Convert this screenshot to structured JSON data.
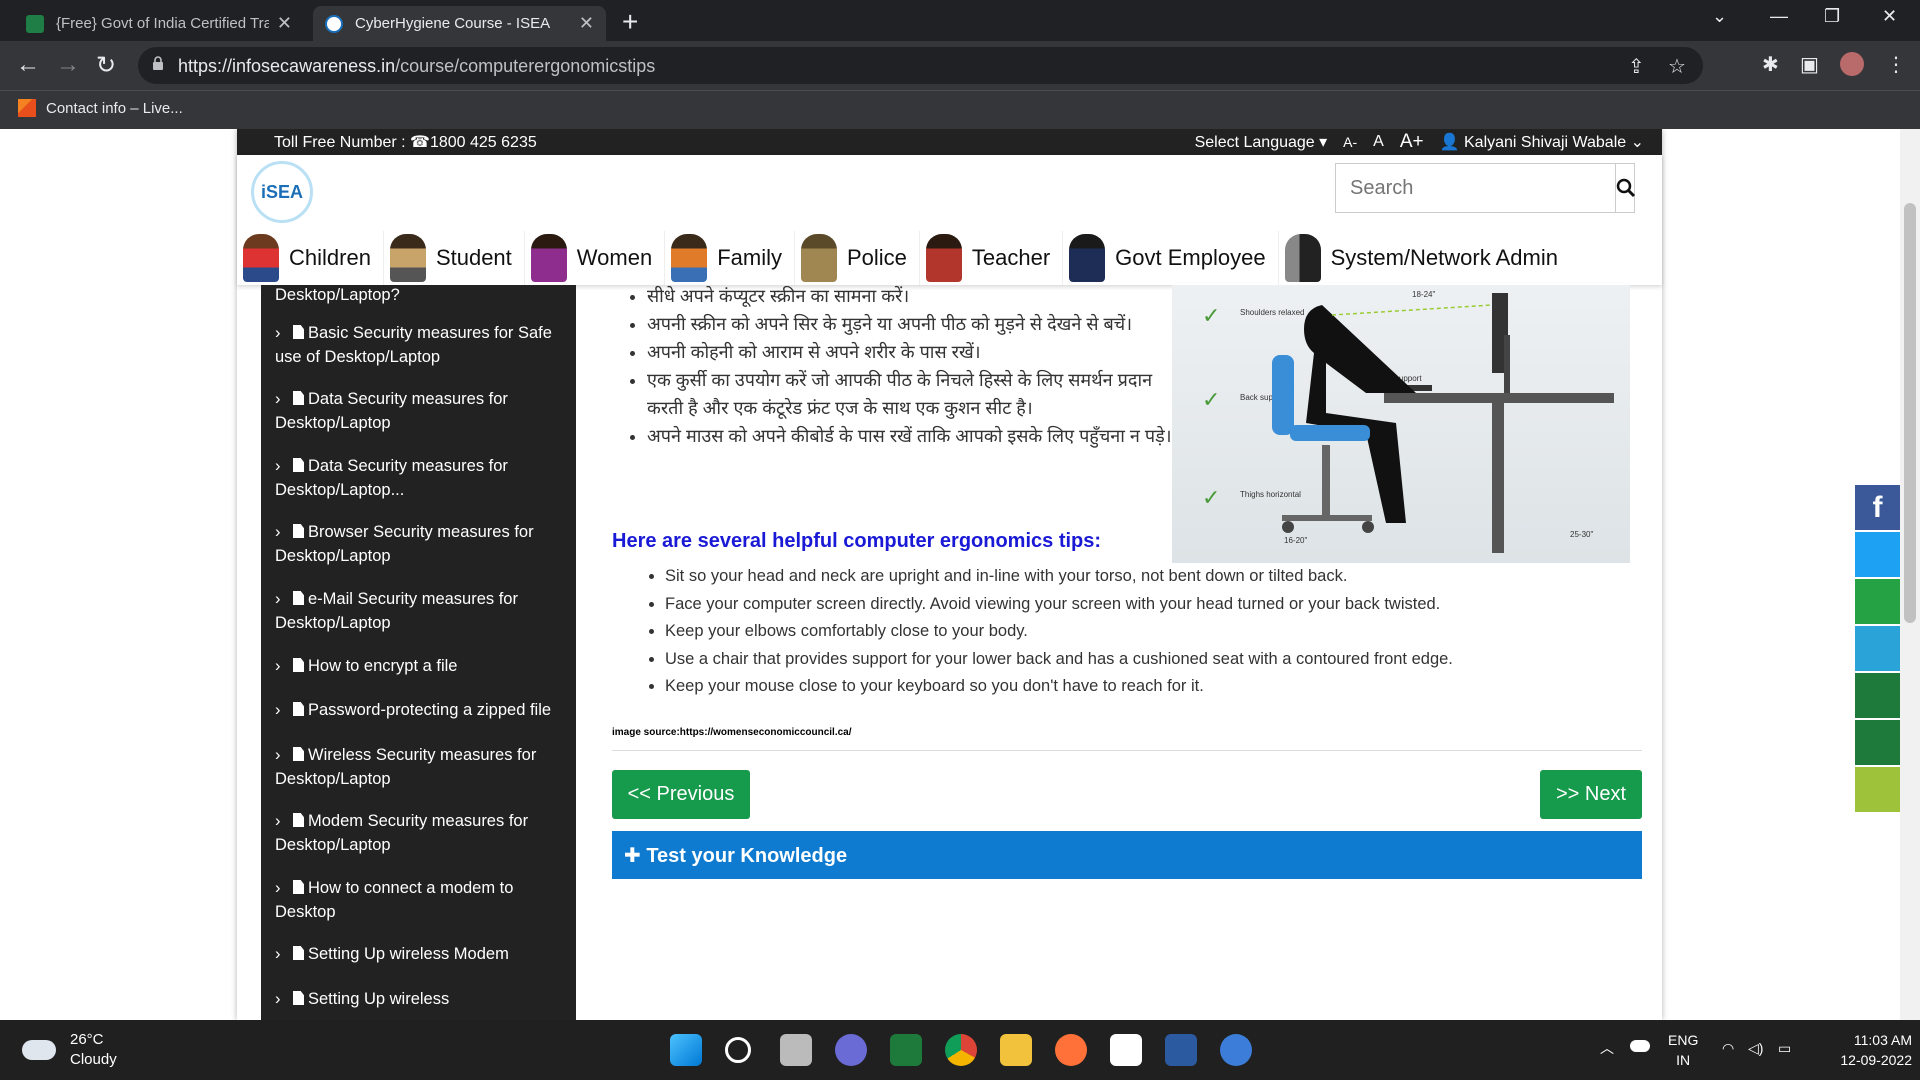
{
  "browser": {
    "tabs": [
      {
        "title": "{Free} Govt of India Certified Trai",
        "active": false
      },
      {
        "title": "CyberHygiene Course - ISEA",
        "active": true
      }
    ],
    "url_host": "https://infosecawareness.in",
    "url_path": "/course/computerergonomicstips",
    "bookmark": "Contact info – Live..."
  },
  "site": {
    "toll_free": "Toll Free Number : ☎1800 425 6235",
    "select_language": "Select Language ▾",
    "font_small": "A-",
    "font_normal": "A",
    "font_large": "A+",
    "user": "👤 Kalyani Shivaji Wabale ⌄",
    "logo_text": "iSEA",
    "search_placeholder": "Search",
    "menu": [
      "Children",
      "Student",
      "Women",
      "Family",
      "Police",
      "Teacher",
      "Govt Employee",
      "System/Network Admin"
    ]
  },
  "sidebar": {
    "items": [
      "Desktop/Laptop?",
      "Basic Security measures for Safe use of Desktop/Laptop",
      "Data Security measures for Desktop/Laptop",
      "Data Security measures for Desktop/Laptop...",
      "Browser Security measures for Desktop/Laptop",
      "e-Mail Security measures for Desktop/Laptop",
      "How to encrypt a file",
      "Password-protecting a zipped file",
      "Wireless Security measures for Desktop/Laptop",
      "Modem Security measures for Desktop/Laptop",
      "How to connect a modem to Desktop",
      "Setting Up wireless Modem",
      "Setting Up wireless"
    ]
  },
  "content": {
    "hindi_items": [
      "सीधे अपने कंप्यूटर स्क्रीन का सामना करें।",
      "अपनी स्क्रीन को अपने सिर के मुड़ने या अपनी पीठ को मुड़ने से देखने से बचें।",
      "अपनी कोहनी को आराम से अपने शरीर के पास रखें।",
      "एक कुर्सी का उपयोग करें जो आपकी पीठ के निचले हिस्से के लिए समर्थन प्रदान करती है और एक कंटूरेड फ्रंट एज के साथ एक कुशन सीट है।",
      "अपने माउस को अपने कीबोर्ड के पास रखें ताकि आपको इसके लिए पहुँचना न पड़े।"
    ],
    "image_labels": {
      "shoulders": "Shoulders relaxed",
      "back": "Back support",
      "thighs": "Thighs horizontal",
      "arm": "Arm support",
      "d1": "18-24\"",
      "d2": "16-20\"",
      "d3": "25-30\""
    },
    "heading": "Here are several helpful computer ergonomics tips:",
    "tips": [
      "Sit so your head and neck are upright and in-line with your torso, not bent down or tilted back.",
      "Face your computer screen directly. Avoid viewing your screen with your head turned or your back twisted.",
      "Keep your elbows comfortably close to your body.",
      "Use a chair that provides support for your lower back and has a cushioned seat with a contoured front edge.",
      "Keep your mouse close to your keyboard so you don't have to reach for it."
    ],
    "image_source": "image source:https://womenseconomiccouncil.ca/",
    "prev_label": "<< Previous",
    "next_label": ">> Next",
    "test_label": "✚ Test your Knowledge"
  },
  "taskbar": {
    "temp": "26°C",
    "weather": "Cloudy",
    "lang1": "ENG",
    "lang2": "IN",
    "time": "11:03 AM",
    "date": "12-09-2022"
  },
  "colors": {
    "green": "#169a4b",
    "blue_bar": "#0e7bd0",
    "heading": "#1a1ad6"
  }
}
